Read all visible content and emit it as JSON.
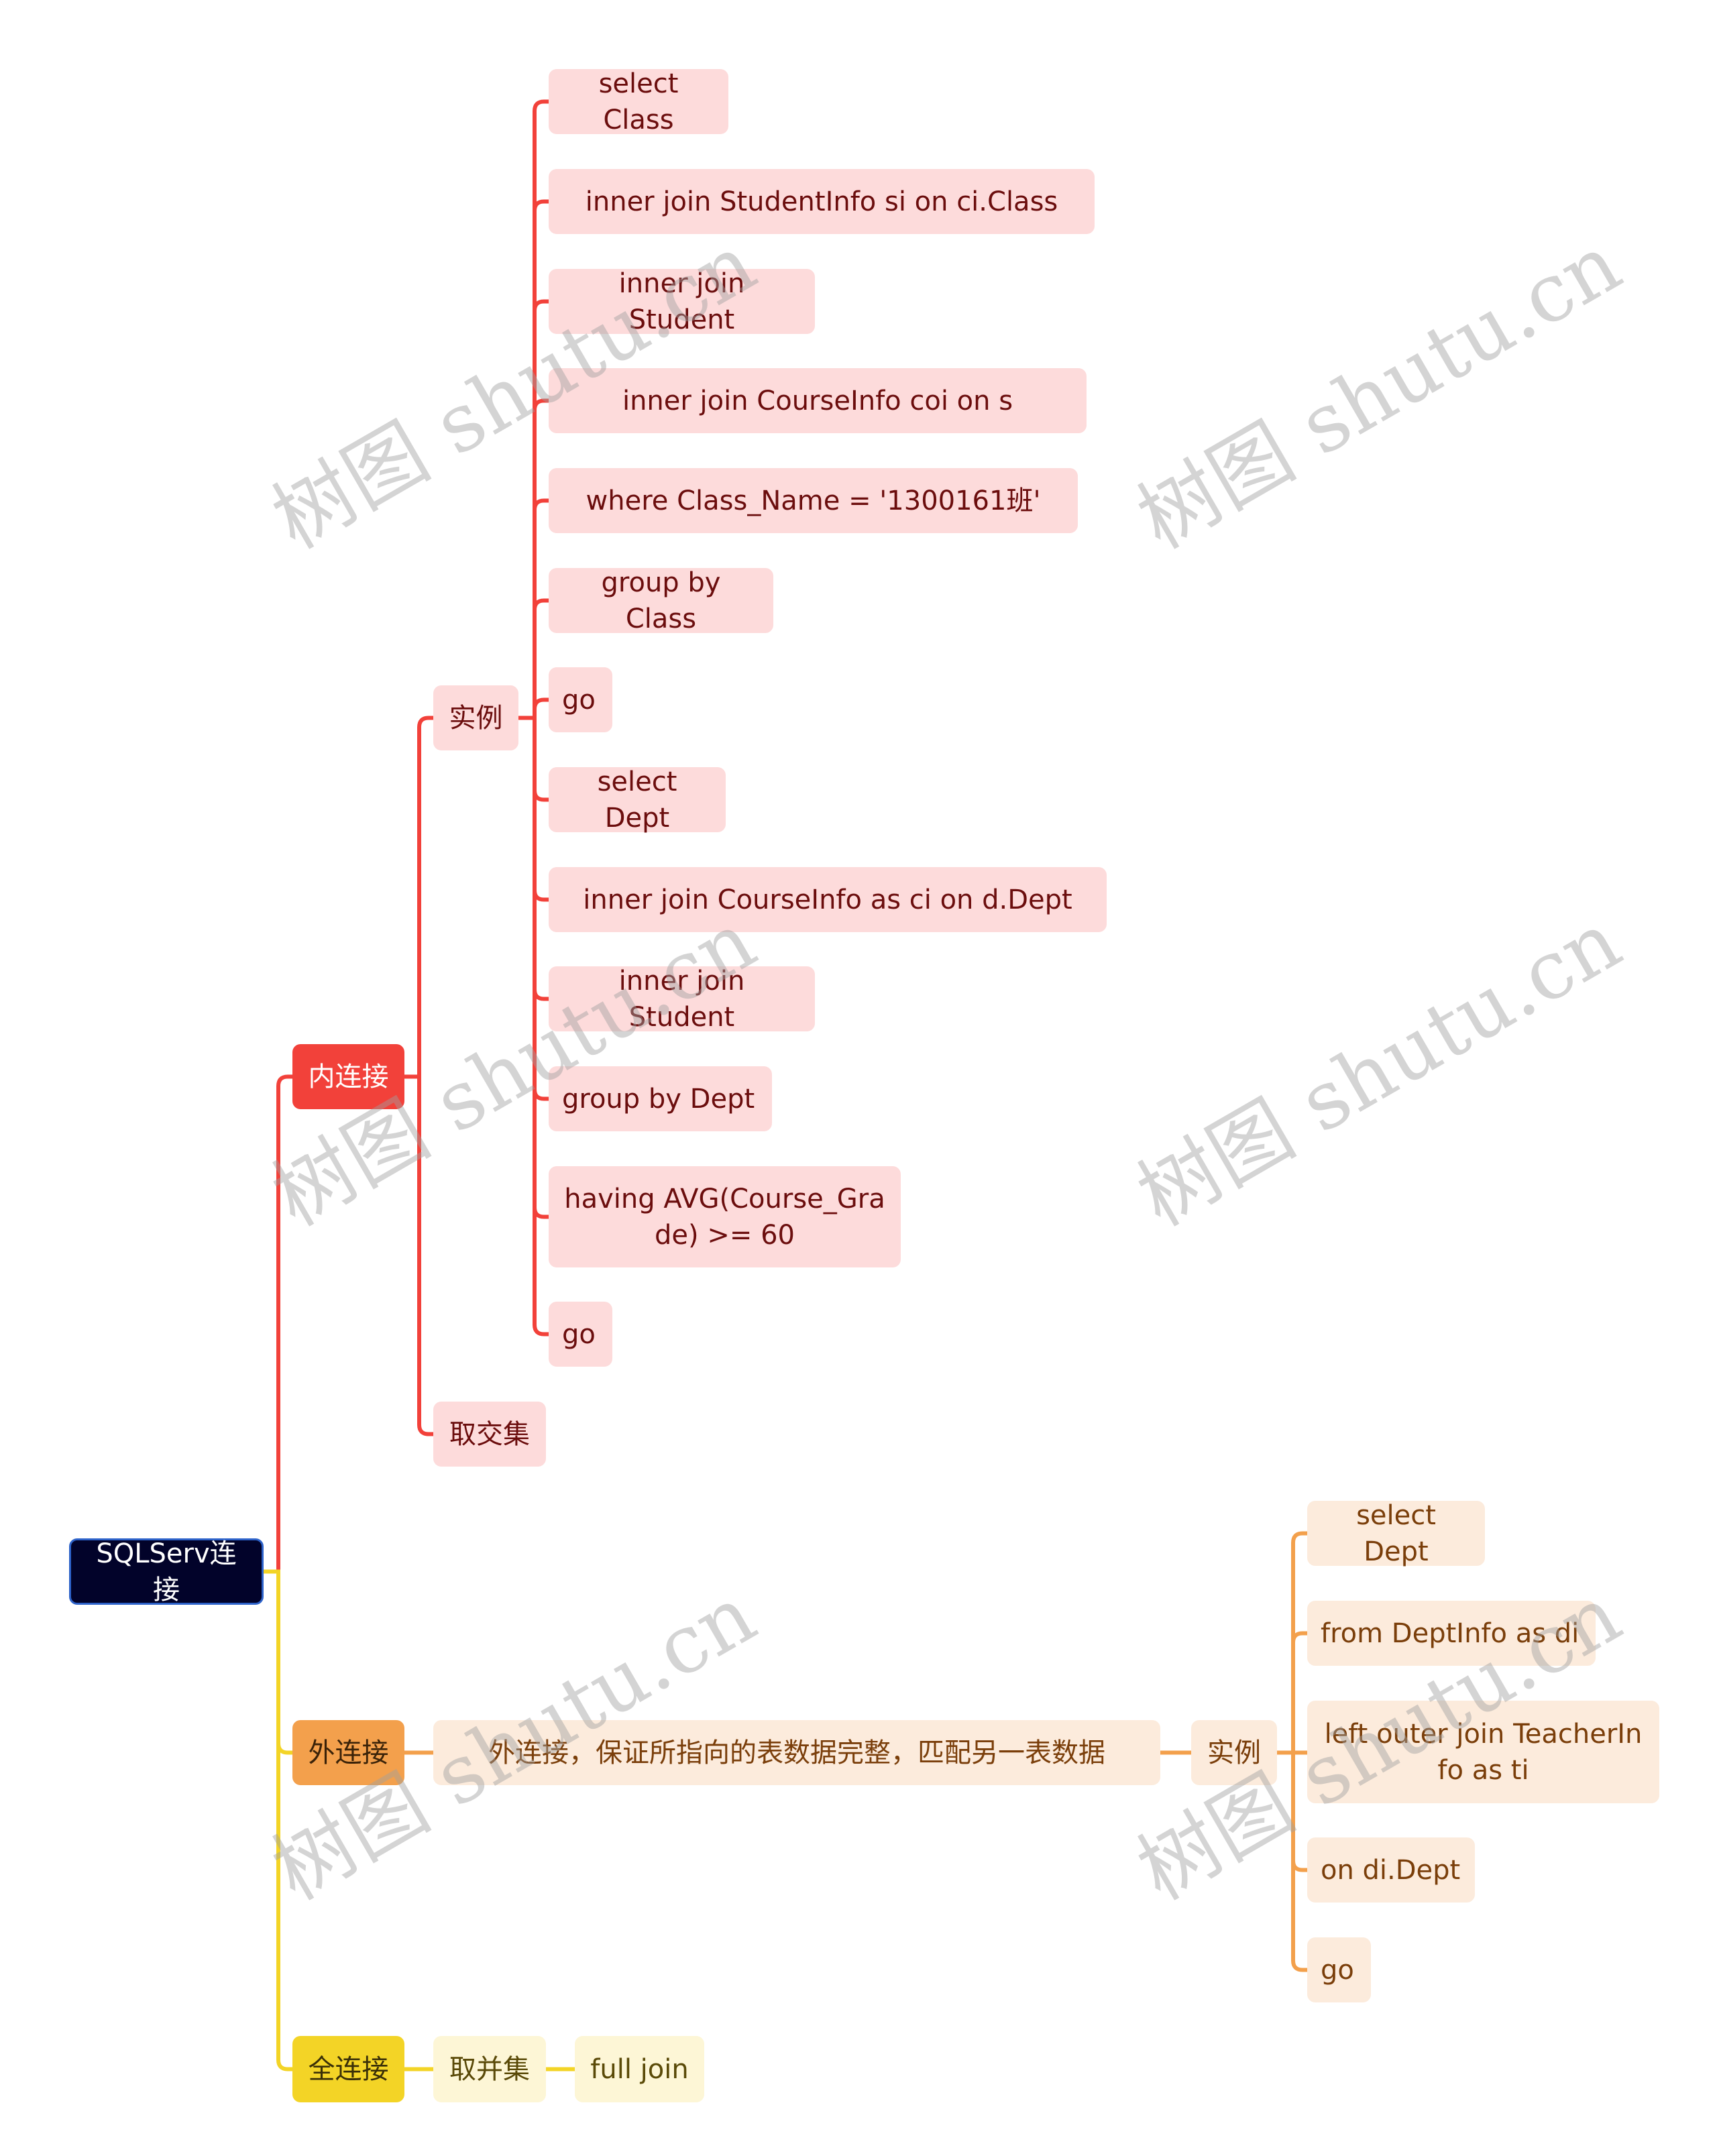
{
  "root": {
    "label": "SQLServ连接",
    "color": "#02032a"
  },
  "branches": {
    "inner": {
      "label": "内连接",
      "color": "#f2413a",
      "example_label": "实例",
      "example_items": [
        "select Class",
        "inner join StudentInfo si on ci.Class",
        "inner join Student",
        "inner join CourseInfo coi on s",
        "where Class_Name = '1300161班'",
        "group by Class",
        "go",
        "select Dept",
        "inner join CourseInfo as ci on d.Dept",
        "inner join Student",
        "group by Dept",
        "having AVG(Course_Gra\nde) >= 60",
        "go"
      ],
      "note": "取交集"
    },
    "outer": {
      "label": "外连接",
      "color": "#f3a04c",
      "description": "外连接，保证所指向的表数据完整，匹配另一表数据",
      "example_label": "实例",
      "example_items": [
        "select Dept",
        "from DeptInfo as di",
        "left outer join TeacherIn\nfo as ti",
        "on di.Dept",
        "go"
      ]
    },
    "full": {
      "label": "全连接",
      "color": "#f3d426",
      "note": "取并集",
      "example": "full join"
    }
  },
  "watermark": "树图 shutu.cn"
}
